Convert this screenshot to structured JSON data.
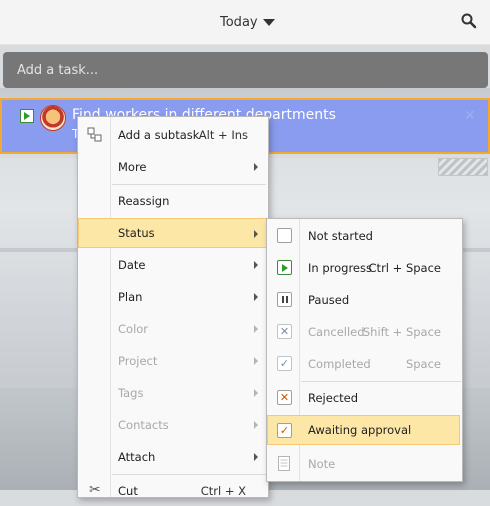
{
  "header": {
    "date_label": "Today"
  },
  "add_task": {
    "placeholder": "Add a task..."
  },
  "task": {
    "title": "Find workers in different departments",
    "subtitle": "T"
  },
  "context_menu": {
    "items": [
      {
        "label": "Add a subtask",
        "shortcut": "Alt + Ins"
      },
      {
        "label": "More"
      },
      {
        "label": "Reassign"
      },
      {
        "label": "Status"
      },
      {
        "label": "Date"
      },
      {
        "label": "Plan"
      },
      {
        "label": "Color"
      },
      {
        "label": "Project"
      },
      {
        "label": "Tags"
      },
      {
        "label": "Contacts"
      },
      {
        "label": "Attach"
      },
      {
        "label": "Cut",
        "shortcut": "Ctrl + X"
      }
    ]
  },
  "status_submenu": {
    "items": [
      {
        "label": "Not started",
        "shortcut": ""
      },
      {
        "label": "In progress",
        "shortcut": "Ctrl + Space"
      },
      {
        "label": "Paused",
        "shortcut": ""
      },
      {
        "label": "Cancelled",
        "shortcut": "Shift + Space"
      },
      {
        "label": "Completed",
        "shortcut": "Space"
      },
      {
        "label": "Rejected",
        "shortcut": ""
      },
      {
        "label": "Awaiting approval",
        "shortcut": ""
      },
      {
        "label": "Note",
        "shortcut": ""
      }
    ]
  },
  "colors": {
    "task_bg": "#8a9cf0",
    "task_border": "#f4a733",
    "highlight": "#fde7a6",
    "add_task_bg": "#777777"
  }
}
